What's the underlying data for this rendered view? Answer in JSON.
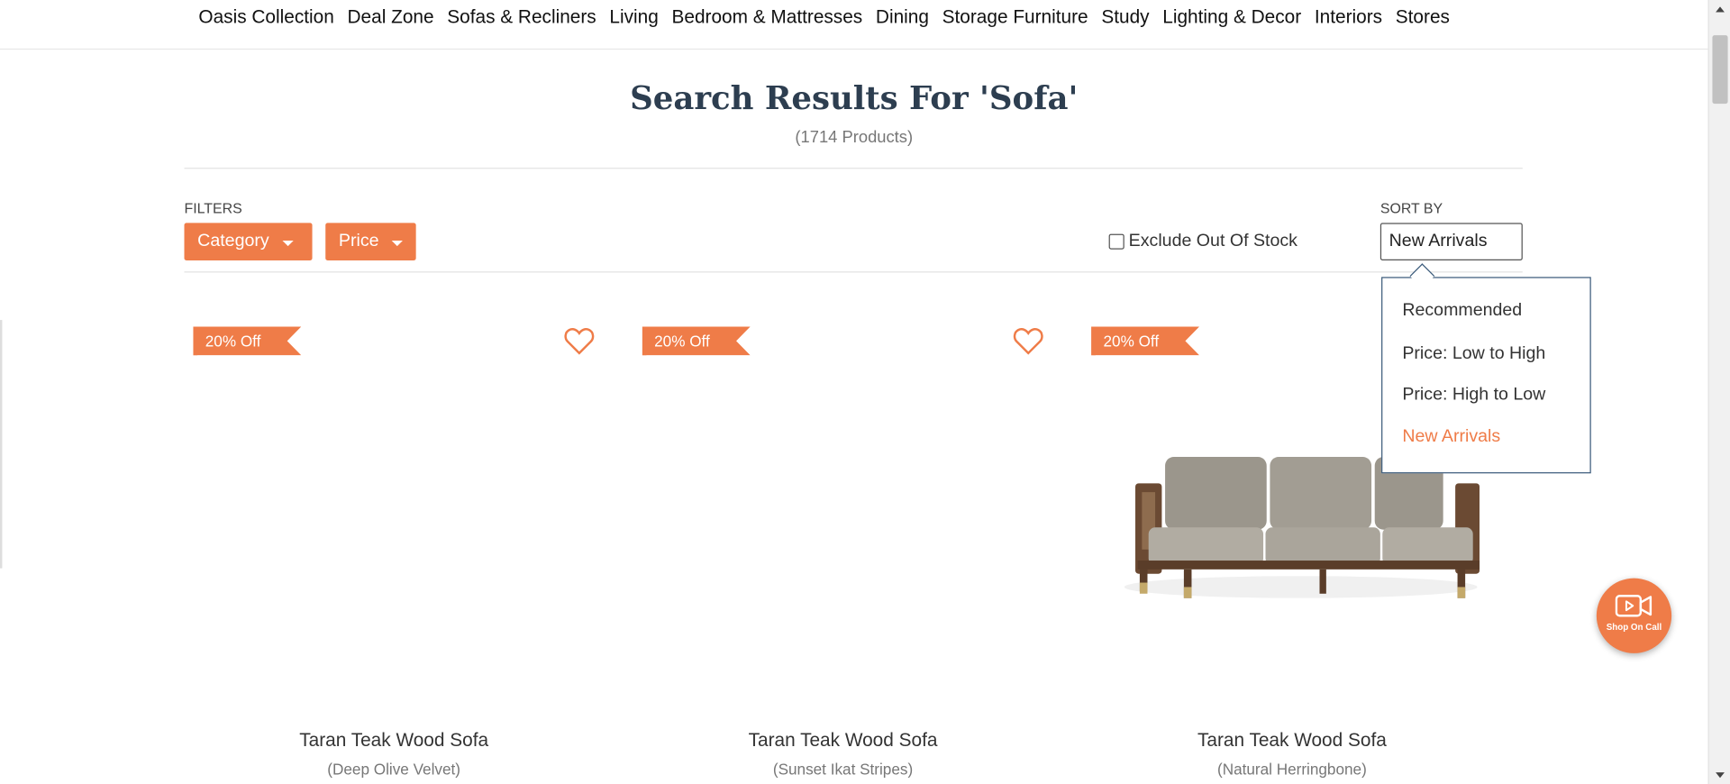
{
  "nav": {
    "items": [
      "Oasis Collection",
      "Deal Zone",
      "Sofas & Recliners",
      "Living",
      "Bedroom & Mattresses",
      "Dining",
      "Storage Furniture",
      "Study",
      "Lighting & Decor",
      "Interiors",
      "Stores"
    ]
  },
  "search": {
    "title": "Search Results For 'Sofa'",
    "count": "(1714 Products)"
  },
  "filters": {
    "label": "FILTERS",
    "category": "Category",
    "price": "Price"
  },
  "exclude_out_of_stock": {
    "label": "Exclude Out Of Stock",
    "checked": false
  },
  "sort": {
    "label": "SORT BY",
    "selected": "New Arrivals",
    "options": [
      "Recommended",
      "Price: Low to High",
      "Price: High to Low",
      "New Arrivals"
    ]
  },
  "products": [
    {
      "badge": "20% Off",
      "name": "Taran Teak Wood Sofa",
      "variant": "(Deep Olive Velvet)",
      "has_image": false
    },
    {
      "badge": "20% Off",
      "name": "Taran Teak Wood Sofa",
      "variant": "(Sunset Ikat Stripes)",
      "has_image": false
    },
    {
      "badge": "20% Off",
      "name": "Taran Teak Wood Sofa",
      "variant": "(Natural Herringbone)",
      "has_image": true
    }
  ],
  "shop_on_call": {
    "label": "Shop On Call"
  },
  "colors": {
    "accent": "#ef7c48",
    "title": "#2d3e50"
  }
}
